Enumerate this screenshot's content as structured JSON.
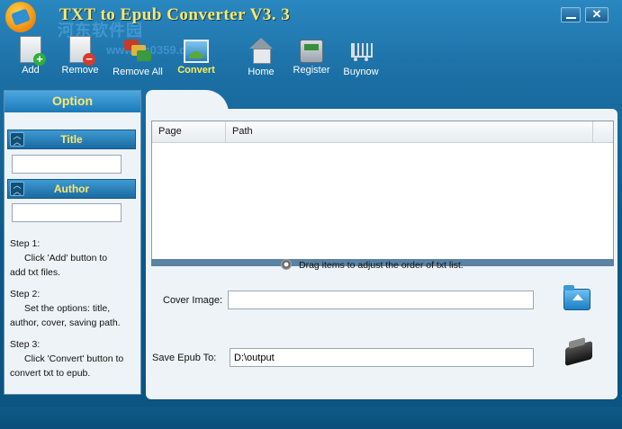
{
  "app": {
    "title": "TXT to Epub Converter V3. 3",
    "watermark": "河东软件园",
    "watermark_url": "www.pc0359.cn"
  },
  "window_controls": {
    "minimize_icon": "minimize-icon",
    "close_icon": "close-icon",
    "close_glyph": "✕"
  },
  "toolbar": {
    "items": [
      {
        "label": "Add",
        "icon": "add-file-icon"
      },
      {
        "label": "Remove",
        "icon": "remove-file-icon"
      },
      {
        "label": "Remove All",
        "icon": "remove-all-icon"
      },
      {
        "label": "Convert",
        "icon": "convert-icon",
        "active": true
      },
      {
        "label": "Home",
        "icon": "home-icon"
      },
      {
        "label": "Register",
        "icon": "register-icon"
      },
      {
        "label": "Buynow",
        "icon": "cart-icon"
      }
    ]
  },
  "option_panel": {
    "header": "Option",
    "title_section": {
      "label": "Title",
      "value": ""
    },
    "author_section": {
      "label": "Author",
      "value": ""
    },
    "steps": [
      {
        "heading": "Step 1:",
        "line1": "Click 'Add' button to",
        "line2": "add txt files."
      },
      {
        "heading": "Step 2:",
        "line1": "Set the options: title,",
        "line2": "author, cover, saving path."
      },
      {
        "heading": "Step 3:",
        "line1": "Click 'Convert' button to",
        "line2": "convert txt to epub."
      }
    ]
  },
  "file_list": {
    "columns": [
      "Page",
      "Path"
    ],
    "rows": []
  },
  "drag_hint": "Drag items to  adjust the order of txt list.",
  "cover_image": {
    "label": "Cover Image:",
    "value": ""
  },
  "save_to": {
    "label": "Save Epub To:",
    "value": "D:\\output"
  },
  "colors": {
    "title_yellow": "#ffe86b",
    "accent_blue": "#1b79b7",
    "panel_bg": "#eef3f7"
  }
}
